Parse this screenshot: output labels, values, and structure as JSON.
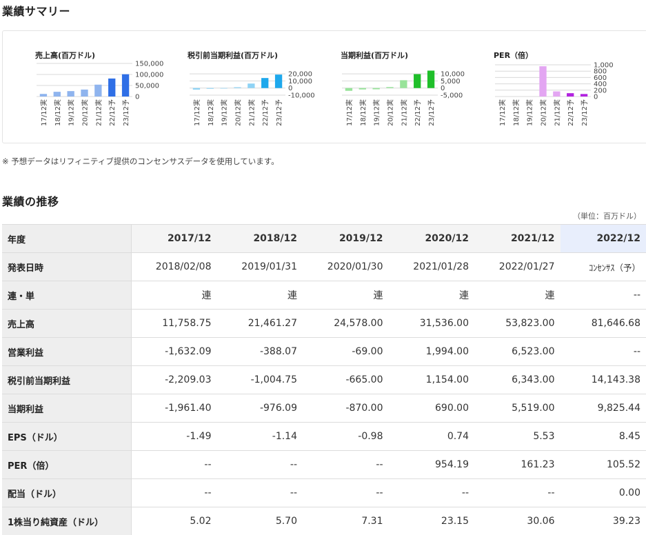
{
  "summary_title": "業績サマリー",
  "history_title": "業績の推移",
  "note": "※ 予想データはリフィニティブ提供のコンセンサスデータを使用しています。",
  "unit": "（単位：百万ドル）",
  "chart_data": [
    {
      "type": "bar",
      "title": "売上高(百万ドル)",
      "categories": [
        "17/12実",
        "18/12実",
        "19/12実",
        "20/12実",
        "21/12実",
        "22/12予",
        "23/12予"
      ],
      "values": [
        11758.75,
        21461.27,
        24578.0,
        31536.0,
        53823.0,
        81646.68,
        101000
      ],
      "colors": [
        "#8fb4ee",
        "#8fb4ee",
        "#8fb4ee",
        "#8fb4ee",
        "#8fb4ee",
        "#2f6fe6",
        "#2f6fe6"
      ],
      "ylim": [
        0,
        150000
      ],
      "yticks": [
        0,
        50000,
        100000,
        150000
      ],
      "ytick_labels": [
        "0",
        "50,000",
        "100,000",
        "150,000"
      ],
      "grid": true
    },
    {
      "type": "bar",
      "title": "税引前当期利益(百万ドル)",
      "categories": [
        "17/12実",
        "18/12実",
        "19/12実",
        "20/12実",
        "21/12実",
        "22/12予",
        "23/12予"
      ],
      "values": [
        -2209.03,
        -1004.75,
        -665.0,
        1154.0,
        6343.0,
        14143.38,
        19000
      ],
      "colors": [
        "#8fd3f5",
        "#8fd3f5",
        "#8fd3f5",
        "#8fd3f5",
        "#8fd3f5",
        "#1ea8ec",
        "#1ea8ec"
      ],
      "ylim": [
        -10000,
        25000
      ],
      "yticks": [
        -10000,
        0,
        10000,
        20000
      ],
      "ytick_labels": [
        "-10,000",
        "0",
        "10,000",
        "20,000"
      ],
      "grid": true
    },
    {
      "type": "bar",
      "title": "当期利益(百万ドル)",
      "categories": [
        "17/12実",
        "18/12実",
        "19/12実",
        "20/12実",
        "21/12実",
        "22/12予",
        "23/12予"
      ],
      "values": [
        -1961.4,
        -976.09,
        -870.0,
        690.0,
        5519.0,
        9825.44,
        12300
      ],
      "colors": [
        "#98e39a",
        "#98e39a",
        "#98e39a",
        "#98e39a",
        "#98e39a",
        "#1fbf2a",
        "#1fbf2a"
      ],
      "ylim": [
        -5000,
        12500
      ],
      "yticks": [
        -5000,
        0,
        5000,
        10000
      ],
      "ytick_labels": [
        "-5,000",
        "0",
        "5,000",
        "10,000"
      ],
      "grid": true
    },
    {
      "type": "bar",
      "title": "PER（倍）",
      "categories": [
        "17/12実",
        "18/12実",
        "19/12実",
        "20/12実",
        "21/12実",
        "22/12予",
        "23/12予"
      ],
      "values": [
        0,
        0,
        0,
        954.19,
        161.23,
        105.52,
        80
      ],
      "colors": [
        "#e3a6f2",
        "#e3a6f2",
        "#e3a6f2",
        "#e3a6f2",
        "#e3a6f2",
        "#b223e0",
        "#b223e0"
      ],
      "ylim": [
        0,
        1000
      ],
      "yticks": [
        0,
        200,
        400,
        600,
        800,
        1000
      ],
      "ytick_labels": [
        "0",
        "200",
        "400",
        "600",
        "800",
        "1,000"
      ],
      "grid": true
    }
  ],
  "table": {
    "header_label": "年度",
    "columns": [
      "2017/12",
      "2018/12",
      "2019/12",
      "2020/12",
      "2021/12",
      "2022/12"
    ],
    "rows": [
      {
        "label": "発表日時",
        "values": [
          "2018/02/08",
          "2019/01/31",
          "2020/01/30",
          "2021/01/28",
          "2022/01/27",
          "ｺﾝｾﾝｻｽ（予）"
        ]
      },
      {
        "label": "連・単",
        "values": [
          "連",
          "連",
          "連",
          "連",
          "連",
          "--"
        ]
      },
      {
        "label": "売上高",
        "values": [
          "11,758.75",
          "21,461.27",
          "24,578.00",
          "31,536.00",
          "53,823.00",
          "81,646.68"
        ]
      },
      {
        "label": "営業利益",
        "values": [
          "-1,632.09",
          "-388.07",
          "-69.00",
          "1,994.00",
          "6,523.00",
          "--"
        ]
      },
      {
        "label": "税引前当期利益",
        "values": [
          "-2,209.03",
          "-1,004.75",
          "-665.00",
          "1,154.00",
          "6,343.00",
          "14,143.38"
        ]
      },
      {
        "label": "当期利益",
        "values": [
          "-1,961.40",
          "-976.09",
          "-870.00",
          "690.00",
          "5,519.00",
          "9,825.44"
        ]
      },
      {
        "label": "EPS（ドル）",
        "values": [
          "-1.49",
          "-1.14",
          "-0.98",
          "0.74",
          "5.53",
          "8.45"
        ]
      },
      {
        "label": "PER（倍）",
        "values": [
          "--",
          "--",
          "--",
          "954.19",
          "161.23",
          "105.52"
        ]
      },
      {
        "label": "配当（ドル）",
        "values": [
          "--",
          "--",
          "--",
          "--",
          "--",
          "0.00"
        ]
      },
      {
        "label": "1株当り純資産（ドル）",
        "values": [
          "5.02",
          "5.70",
          "7.31",
          "23.15",
          "30.06",
          "39.23"
        ]
      }
    ]
  }
}
